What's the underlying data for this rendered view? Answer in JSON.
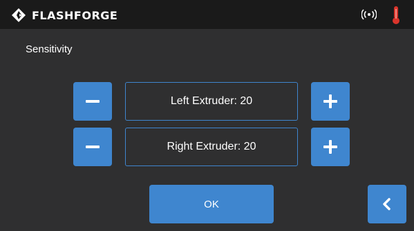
{
  "header": {
    "brand_name": "FLASHFORGE",
    "icons": [
      "flashforge-logo-icon",
      "wifi-icon",
      "thermometer-icon"
    ]
  },
  "page": {
    "title": "Sensitivity"
  },
  "extruders": [
    {
      "label": "Left Extruder: 20"
    },
    {
      "label": "Right Extruder: 20"
    }
  ],
  "buttons": {
    "ok_label": "OK"
  },
  "colors": {
    "accent": "#3f86cf",
    "background": "#2f2f30",
    "topbar": "#1a1a1a",
    "temperature": "#d9342b"
  }
}
